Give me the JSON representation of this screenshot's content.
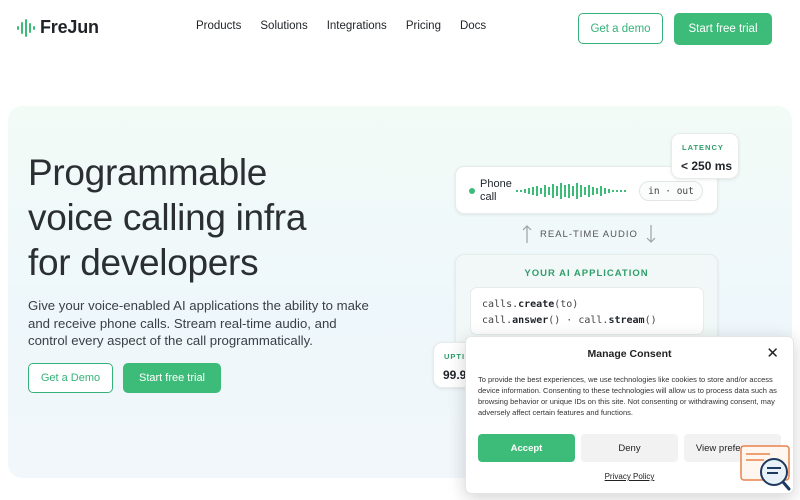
{
  "brand": {
    "name": "FreJun",
    "accent": "#3dbb78"
  },
  "nav": {
    "links": [
      "Products",
      "Solutions",
      "Integrations",
      "Pricing",
      "Docs"
    ],
    "demo_label": "Get a demo",
    "trial_label": "Start free trial"
  },
  "hero": {
    "title_lines": [
      "Programmable",
      "voice calling infra",
      "for developers"
    ],
    "subtitle": "Give your voice-enabled AI applications the ability to make and receive phone calls. Stream real-time audio, and control every aspect of the call programmatically.",
    "demo_label": "Get a Demo",
    "trial_label": "Start free trial"
  },
  "diagram": {
    "phone_call": "Phone call",
    "io_pill": "in · out",
    "latency_caption": "LATENCY",
    "latency_value": "< 250 ms",
    "realtime_label": "REAL-TIME AUDIO",
    "ai_title": "YOUR AI APPLICATION",
    "code_line1_prefix": "calls.",
    "code_line1_method": "create",
    "code_line1_suffix": "(to)",
    "code_line2_a_prefix": "call.",
    "code_line2_a_method": "answer",
    "code_line2_a_suffix": "()",
    "code_line2_sep": " · ",
    "code_line2_b_prefix": "call.",
    "code_line2_b_method": "stream",
    "code_line2_b_suffix": "()",
    "uptime_caption": "UPTIM",
    "uptime_value": "99.9"
  },
  "consent": {
    "title": "Manage Consent",
    "body": "To provide the best experiences, we use technologies like cookies to store and/or access device information. Consenting to these technologies will allow us to process data such as browsing behavior or unique IDs on this site. Not consenting or withdrawing consent, may adversely affect certain features and functions.",
    "accept_label": "Accept",
    "deny_label": "Deny",
    "prefs_label": "View preferences",
    "policy_label": "Privacy Policy"
  }
}
